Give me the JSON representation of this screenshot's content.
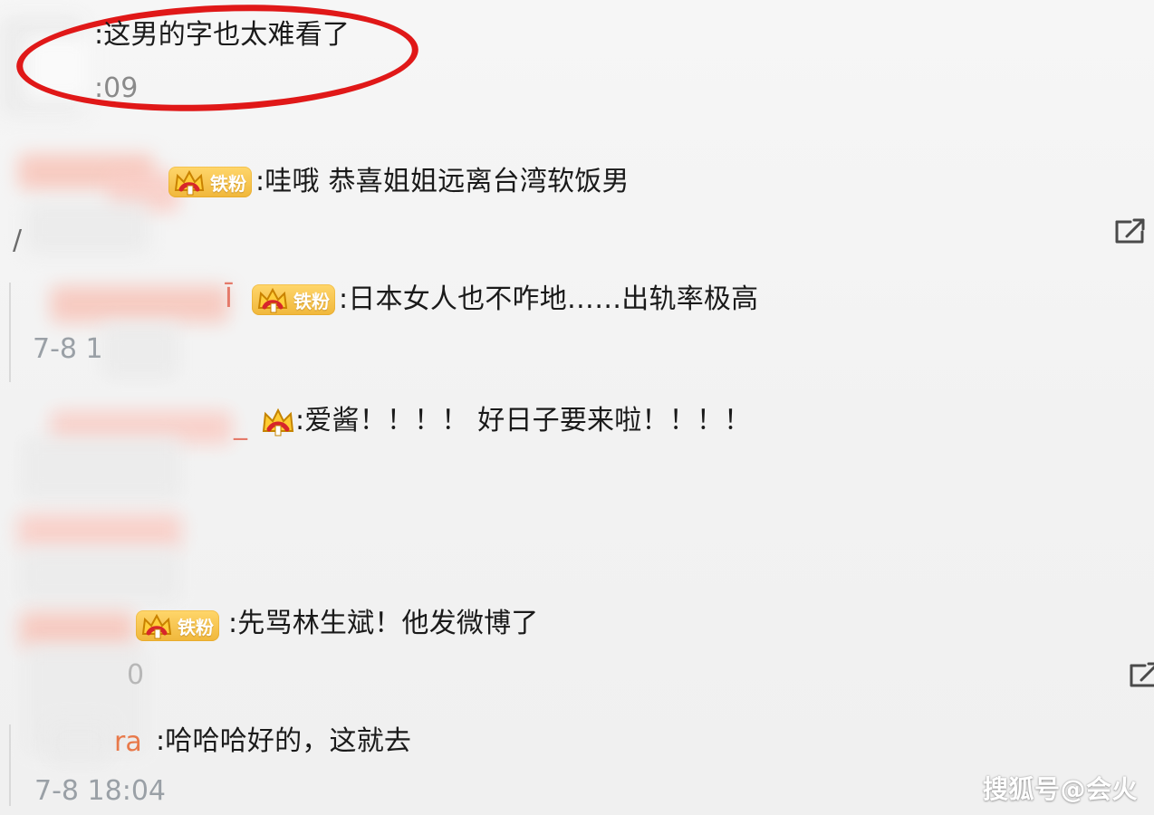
{
  "colors": {
    "background": "#f3f3f3",
    "text": "#1a1a1a",
    "meta_text": "#9aa0a6",
    "highlight": "#e01818",
    "badge_gold": "#f0b73b",
    "username_orange": "#e8794a",
    "watermark": "#ffffff"
  },
  "comments": [
    {
      "text": ":这男的字也太难看了",
      "meta": ":09",
      "highlighted": true
    },
    {
      "badge_label": "铁粉",
      "text": ":哇哦 恭喜姐姐远离台湾软饭男",
      "meta_fragment": "/"
    },
    {
      "suffix": "Ī",
      "badge_label": "铁粉",
      "text": ":日本女人也不咋地……出轨率极高",
      "meta": "7-8 1"
    },
    {
      "suffix": "_",
      "badge": "crown-icon",
      "text": ":爱酱！！！！ 好日子要来啦！！！！"
    },
    {
      "badge_label": "铁粉",
      "text": ":先骂林生斌！他发微博了",
      "meta": "0"
    },
    {
      "username_fragment": "ra",
      "text": ":哈哈哈好的，这就去",
      "meta": "7-8 18:04"
    }
  ],
  "icons": {
    "forward": "share-forward-icon",
    "crown": "crown-icon"
  },
  "watermark": {
    "text": "搜狐号@会火"
  }
}
